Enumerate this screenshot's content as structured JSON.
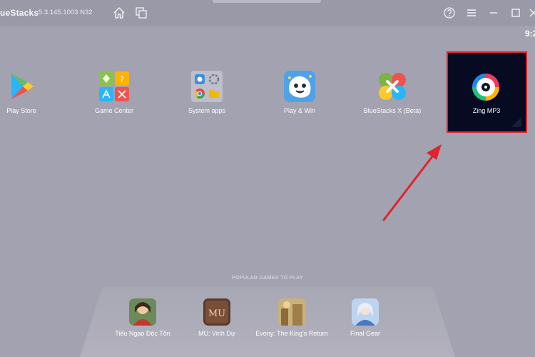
{
  "titlebar": {
    "title": "ueStacks",
    "version": "5.3.145.1003  N32"
  },
  "status_bar": {
    "clock": "9:2"
  },
  "home_apps": [
    {
      "label": "Play Store",
      "icon": "play-store-icon"
    },
    {
      "label": "Game Center",
      "icon": "game-center-icon"
    },
    {
      "label": "System apps",
      "icon": "system-apps-icon"
    },
    {
      "label": "Play & Win",
      "icon": "play-and-win-icon"
    },
    {
      "label": "BlueStacks X (Beta)",
      "icon": "bluestacks-x-icon"
    }
  ],
  "highlighted_app": {
    "label": "Zing MP3",
    "icon": "zing-mp3-icon"
  },
  "popular": {
    "title": "POPULAR GAMES TO PLAY",
    "games": [
      {
        "label": "Tiếu Ngạo Độc Tôn"
      },
      {
        "label": "MU: Vinh Dự"
      },
      {
        "label": "Evony: The King's Return"
      },
      {
        "label": "Final Gear"
      }
    ]
  },
  "colors": {
    "background": "#a3a2b0",
    "highlight_border": "#e0242b",
    "arrow": "#e0242b",
    "highlight_fill": "#070b22"
  }
}
